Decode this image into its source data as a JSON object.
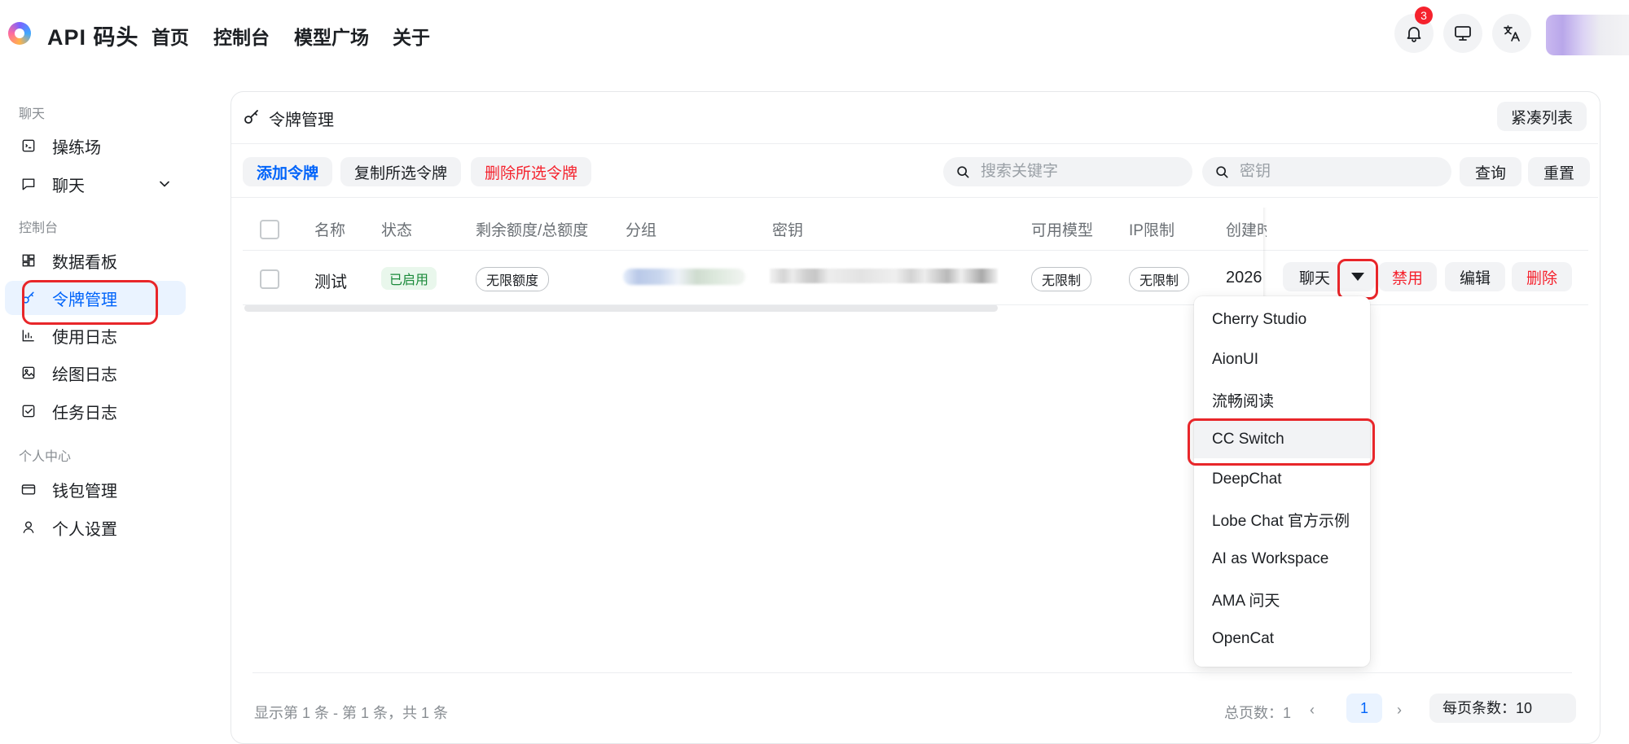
{
  "header": {
    "app_title": "API 码头",
    "nav": [
      "首页",
      "控制台",
      "模型广场",
      "关于"
    ],
    "notification_count": "3",
    "icons": [
      "bell-icon",
      "monitor-icon",
      "translate-icon"
    ]
  },
  "sidebar": {
    "sections": {
      "chat": "聊天",
      "console": "控制台",
      "personal": "个人中心"
    },
    "items": [
      {
        "label": "操练场",
        "icon": "playground-icon"
      },
      {
        "label": "聊天",
        "icon": "chat-icon"
      },
      {
        "label": "数据看板",
        "icon": "dashboard-icon"
      },
      {
        "label": "令牌管理",
        "icon": "key-icon",
        "active": true
      },
      {
        "label": "使用日志",
        "icon": "bar-chart-icon"
      },
      {
        "label": "绘图日志",
        "icon": "image-icon"
      },
      {
        "label": "任务日志",
        "icon": "checklist-icon"
      },
      {
        "label": "钱包管理",
        "icon": "wallet-icon"
      },
      {
        "label": "个人设置",
        "icon": "user-icon"
      }
    ]
  },
  "page": {
    "title": "令牌管理",
    "compact_label": "紧凑列表"
  },
  "toolbar": {
    "add_label": "添加令牌",
    "copy_label": "复制所选令牌",
    "delete_label": "删除所选令牌",
    "search_placeholder": "搜索关键字",
    "key_placeholder": "密钥",
    "query_label": "查询",
    "reset_label": "重置"
  },
  "table": {
    "headers": [
      "名称",
      "状态",
      "剩余额度/总额度",
      "分组",
      "密钥",
      "可用模型",
      "IP限制",
      "创建时"
    ],
    "rows": [
      {
        "name": "测试",
        "status": "已启用",
        "quota": "无限额度",
        "models": "无限制",
        "ip": "无限制",
        "created": "2026",
        "actions": {
          "chat": "聊天",
          "disable": "禁用",
          "edit": "编辑",
          "delete": "删除"
        }
      }
    ]
  },
  "dropdown": {
    "items": [
      "Cherry Studio",
      "AionUI",
      "流畅阅读",
      "CC Switch",
      "DeepChat",
      "Lobe Chat 官方示例",
      "AI as Workspace",
      "AMA 问天",
      "OpenCat"
    ],
    "highlighted": "CC Switch"
  },
  "footer": {
    "summary": "显示第 1 条 - 第 1 条，共 1 条",
    "total_pages": "总页数：1",
    "current_page": "1",
    "page_size": "每页条数：10"
  },
  "colors": {
    "accent": "#0064fa",
    "danger": "#f5222d",
    "success": "#1a8a3a",
    "annotation_ring": "#e8262a"
  }
}
